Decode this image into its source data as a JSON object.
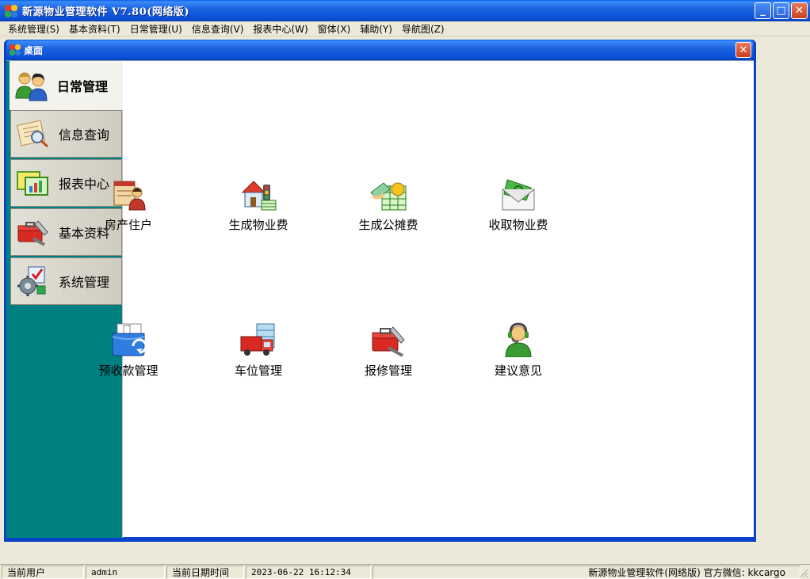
{
  "app": {
    "title": "新源物业管理软件 V7.80(网络版)",
    "accent": "#0a4fd6"
  },
  "window_buttons": {
    "minimize": "_",
    "maximize": "□",
    "close": "✕"
  },
  "menu": [
    "系统管理(S)",
    "基本资料(T)",
    "日常管理(U)",
    "信息查询(V)",
    "报表中心(W)",
    "窗体(X)",
    "辅助(Y)",
    "导航图(Z)"
  ],
  "desktop": {
    "title": "桌面",
    "close": "✕"
  },
  "sidebar": {
    "items": [
      {
        "label": "日常管理",
        "icon": "users-icon",
        "active": true
      },
      {
        "label": "信息查询",
        "icon": "document-search-icon",
        "active": false
      },
      {
        "label": "报表中心",
        "icon": "report-chart-icon",
        "active": false
      },
      {
        "label": "基本资料",
        "icon": "toolbox-icon",
        "active": false
      },
      {
        "label": "系统管理",
        "icon": "system-settings-icon",
        "active": false
      }
    ],
    "color": "#008080"
  },
  "tiles": [
    {
      "label": "房产住户",
      "icon": "resident-icon"
    },
    {
      "label": "生成物业费",
      "icon": "property-fee-icon"
    },
    {
      "label": "生成公摊费",
      "icon": "shared-fee-icon"
    },
    {
      "label": "收取物业费",
      "icon": "money-envelope-icon"
    },
    {
      "label": "预收款管理",
      "icon": "prepayment-icon"
    },
    {
      "label": "车位管理",
      "icon": "parking-icon"
    },
    {
      "label": "报修管理",
      "icon": "repair-toolbox-icon"
    },
    {
      "label": "建议意见",
      "icon": "support-agent-icon"
    }
  ],
  "status": {
    "user_label": "当前用户",
    "user_value": "admin",
    "date_label": "当前日期时间",
    "date_value": "2023-06-22 16:12:34",
    "info": "新源物业管理软件(网络版) 官方微信: kkcargo"
  }
}
